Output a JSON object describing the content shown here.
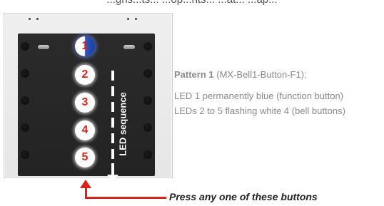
{
  "top_text": "...gns...ts... ...op...nts... ...at... ...ap...",
  "leds": [
    {
      "number": "1",
      "color": "blue"
    },
    {
      "number": "2",
      "color": "white"
    },
    {
      "number": "3",
      "color": "white"
    },
    {
      "number": "4",
      "color": "white"
    },
    {
      "number": "5",
      "color": "white"
    }
  ],
  "led_sequence_label": "LED sequence",
  "pattern": {
    "title_bold": "Pattern 1",
    "title_rest": " (MX-Bell1-Button-F1):",
    "line1": "LED 1 permanently blue (function button)",
    "line2": "LEDs 2 to 5 flashing white 4 (bell buttons)"
  },
  "press_label": "Press any one of these buttons",
  "colors": {
    "accent_red": "#d8241b",
    "led_number_red": "#d1261b",
    "blue": "#2a56c7",
    "panel": "#262626",
    "text_gray": "#8a8a8a"
  }
}
